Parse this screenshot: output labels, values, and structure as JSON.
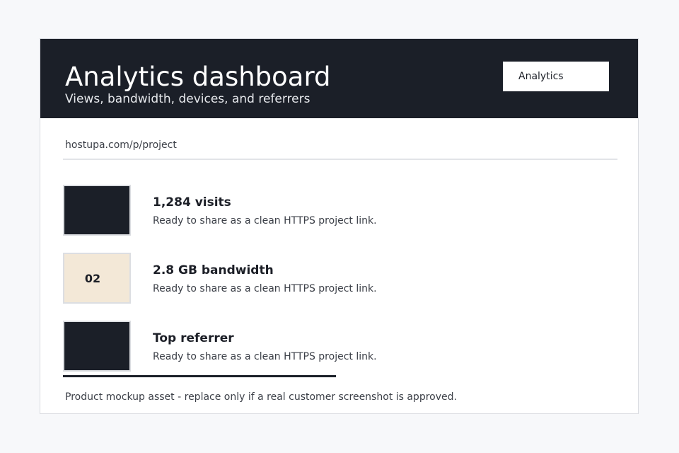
{
  "header": {
    "title": "Analytics dashboard",
    "subtitle": "Views, bandwidth, devices, and referrers",
    "nav_button_label": "Analytics"
  },
  "project_url": "hostupa.com/p/project",
  "stats": [
    {
      "thumb_label": "",
      "title": "1,284 visits",
      "description": "Ready to share as a clean HTTPS project link."
    },
    {
      "thumb_label": "02",
      "title": "2.8 GB bandwidth",
      "description": "Ready to share as a clean HTTPS project link."
    },
    {
      "thumb_label": "",
      "title": "Top referrer",
      "description": "Ready to share as a clean HTTPS project link."
    }
  ],
  "footer_note": "Product mockup asset - replace only if a real customer screenshot is approved.",
  "colors": {
    "header_bg": "#1b1f28",
    "page_bg": "#f7f8fa",
    "accent_tile": "#f3e8d7"
  }
}
